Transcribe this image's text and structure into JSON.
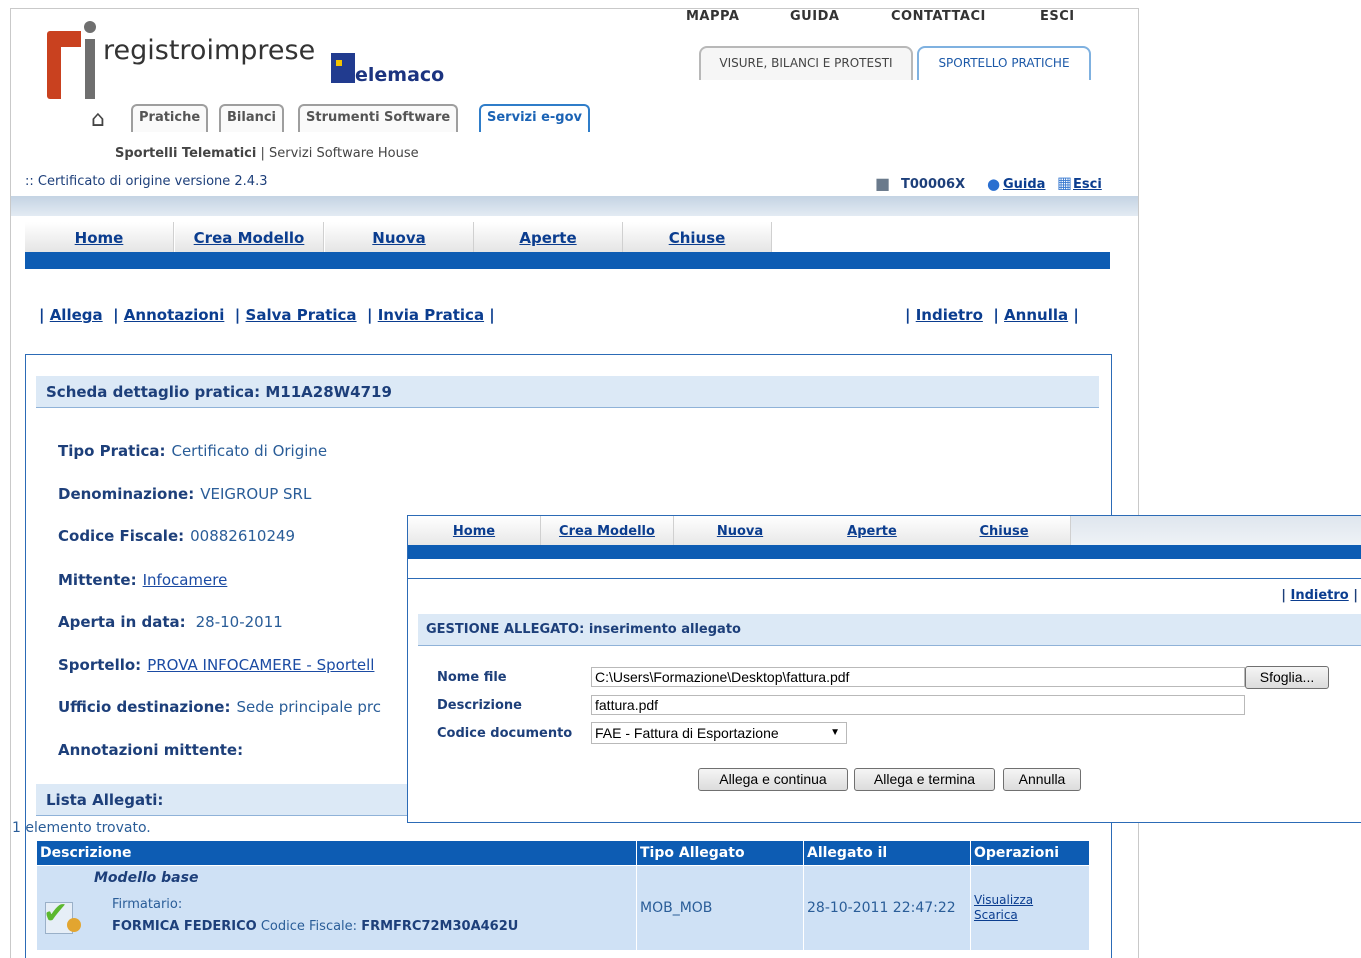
{
  "brand": {
    "logo_text": "registroimprese",
    "telemaco_text": "elemaco"
  },
  "top_links": [
    "MAPPA",
    "GUIDA",
    "CONTATTACI",
    "ESCI"
  ],
  "service_tabs": [
    "VISURE, BILANCI E PROTESTI",
    "SPORTELLO PRATICHE"
  ],
  "nav_tabs": [
    "Pratiche",
    "Bilanci",
    "Strumenti Software",
    "Servizi e-gov"
  ],
  "subnav": {
    "active": "Sportelli Telematici",
    "sep": " | ",
    "other": "Servizi Software House"
  },
  "cert_version": ":: Certificato di origine versione 2.4.3",
  "user": {
    "id": "T00006X",
    "guida": "Guida",
    "esci": "Esci"
  },
  "menu": [
    "Home",
    "Crea Modello",
    "Nuova",
    "Aperte",
    "Chiuse"
  ],
  "actions_left": [
    "Allega",
    "Annotazioni",
    "Salva Pratica",
    "Invia Pratica"
  ],
  "actions_right": [
    "Indietro",
    "Annulla"
  ],
  "detail": {
    "header": "Scheda dettaglio pratica: M11A28W4719",
    "tipo_label": "Tipo Pratica:",
    "tipo_value": "Certificato di Origine",
    "den_label": "Denominazione:",
    "den_value": "VEIGROUP SRL",
    "cf_label": "Codice Fiscale:",
    "cf_value": "00882610249",
    "mitt_label": "Mittente:",
    "mitt_value": "Infocamere",
    "aperta_label": "Aperta in data:",
    "aperta_value": "28-10-2011",
    "sportello_label": "Sportello:",
    "sportello_value": "PROVA INFOCAMERE - Sportell",
    "ufficio_label": "Ufficio destinazione:",
    "ufficio_value": "Sede principale prc",
    "annot_label": "Annotazioni mittente:"
  },
  "attachments": {
    "header": "Lista Allegati:",
    "found": "1 elemento trovato.",
    "columns": [
      "Descrizione",
      "Tipo Allegato",
      "Allegato il",
      "Operazioni"
    ],
    "row": {
      "title": "Modello base",
      "firmatario_label": "Firmatario:",
      "signer": "FORMICA FEDERICO",
      "cf_label": " Codice Fiscale: ",
      "cf": "FRMFRC72M30A462U",
      "tipo": "MOB_MOB",
      "date": "28-10-2011 22:47:22",
      "op_view": "Visualizza",
      "op_download": "Scarica"
    }
  },
  "dialog": {
    "menu": [
      "Home",
      "Crea Modello",
      "Nuova",
      "Aperte",
      "Chiuse"
    ],
    "indietro": "Indietro",
    "header": "GESTIONE ALLEGATO: inserimento allegato",
    "nome_label": "Nome file",
    "nome_value": "C:\\Users\\Formazione\\Desktop\\fattura.pdf",
    "browse": "Sfoglia...",
    "desc_label": "Descrizione",
    "desc_value": "fattura.pdf",
    "codice_label": "Codice documento",
    "codice_value": "FAE - Fattura di Esportazione",
    "btn_continue": "Allega e continua",
    "btn_finish": "Allega e termina",
    "btn_cancel": "Annulla"
  }
}
